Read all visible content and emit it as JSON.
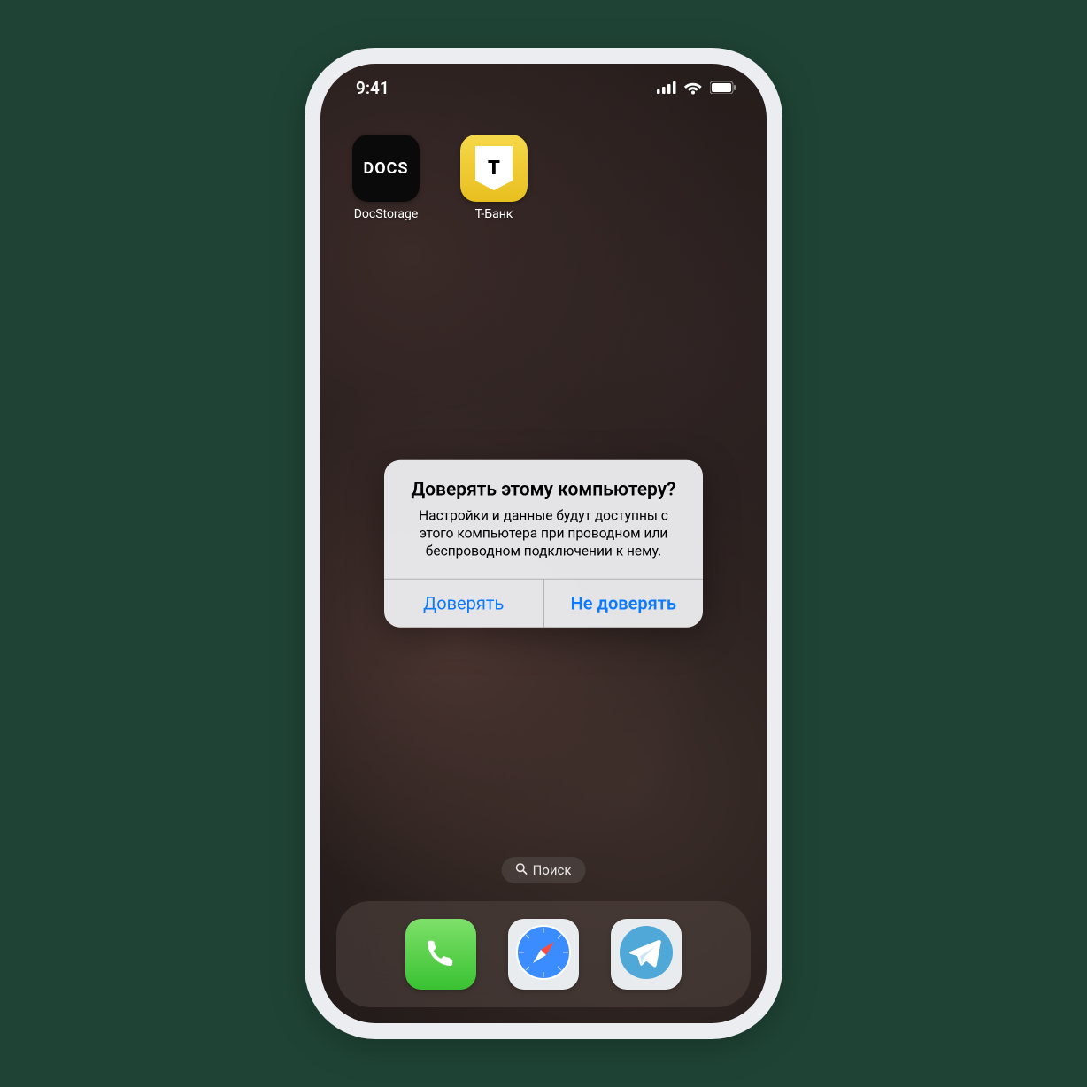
{
  "status": {
    "time": "9:41"
  },
  "apps": {
    "docstorage": {
      "label": "DocStorage",
      "icon_text": "DOCS"
    },
    "tbank": {
      "label": "Т-Банк",
      "badge_letter": "T"
    }
  },
  "search": {
    "label": "Поиск"
  },
  "alert": {
    "title": "Доверять этому компьютеру?",
    "message": "Настройки и данные будут доступны с этого компьютера при проводном или беспроводном подключении к нему.",
    "trust": "Доверять",
    "dont_trust": "Не доверять"
  }
}
